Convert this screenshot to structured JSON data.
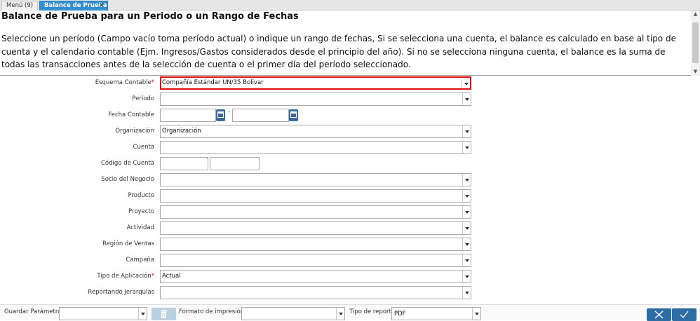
{
  "tabs": [
    {
      "label": "Menú (9)"
    },
    {
      "label": "Balance de Prueba"
    }
  ],
  "header": {
    "title": "Balance de Prueba para un Periodo o un Rango de Fechas",
    "description": "Seleccione un período (Campo vacío toma período actual) o indique un rango de fechas, Si se selecciona una cuenta, el balance es calculado en base al tipo de cuenta y el calendario contable (Ejm. Ingresos/Gastos considerados desde el principio del año). Si no se selecciona ninguna cuenta, el balance es la suma de todas las transacciones antes de la selección de cuenta o el primer día del período seleccionado."
  },
  "form": {
    "esquema": {
      "label": "Esquema Contable",
      "value": "Compañía Estándar UN/35 Bolivar"
    },
    "periodo": {
      "label": "Período",
      "value": ""
    },
    "fecha": {
      "label": "Fecha Contable",
      "separator": "-"
    },
    "organizacion": {
      "label": "Organización",
      "value": "Organización"
    },
    "cuenta": {
      "label": "Cuenta",
      "value": ""
    },
    "codigo": {
      "label": "Código de Cuenta",
      "separator": "-"
    },
    "socio": {
      "label": "Socio del Negocio",
      "value": ""
    },
    "producto": {
      "label": "Producto",
      "value": ""
    },
    "proyecto": {
      "label": "Proyecto",
      "value": ""
    },
    "actividad": {
      "label": "Actividad",
      "value": ""
    },
    "region": {
      "label": "Región de Ventas",
      "value": ""
    },
    "campana": {
      "label": "Campaña",
      "value": ""
    },
    "tipo_aplicacion": {
      "label": "Tipo de Aplicación",
      "value": "Actual"
    },
    "jerarquias": {
      "label": "Reportando Jerarquías",
      "value": ""
    },
    "required_mark": "*"
  },
  "footer": {
    "guardar_label": "Guardar Parámetro",
    "formato_label": "Formato de impresión",
    "tipo_reporte_label": "Tipo de reporte",
    "tipo_reporte_value": "PDF"
  },
  "icons": {
    "close": "close-icon",
    "dropdown": "chevron-down-icon",
    "calendar": "calendar-icon",
    "trash": "trash-icon",
    "cancel": "x-icon",
    "ok": "check-icon"
  },
  "colors": {
    "tab_active": "#2f8fd0",
    "required": "#dd0000",
    "highlight_border": "#e01010",
    "button": "#2e6da4"
  }
}
